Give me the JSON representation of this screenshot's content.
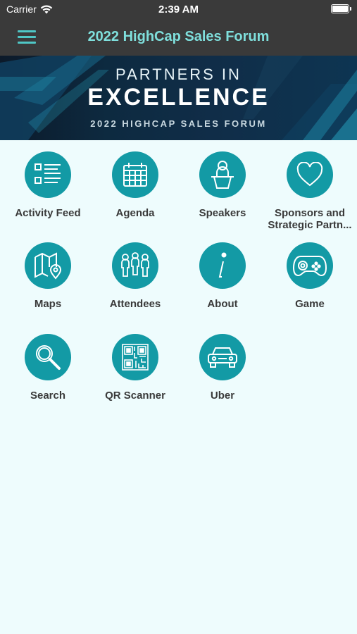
{
  "status": {
    "carrier": "Carrier",
    "time": "2:39 AM"
  },
  "nav": {
    "title": "2022 HighCap Sales Forum",
    "menu_icon": "hamburger-menu-icon"
  },
  "banner": {
    "line1": "PARTNERS IN",
    "line2": "EXCELLENCE",
    "line3": "2022 HIGHCAP SALES FORUM"
  },
  "tiles": [
    {
      "label": "Activity Feed",
      "icon": "list-icon"
    },
    {
      "label": "Agenda",
      "icon": "calendar-icon"
    },
    {
      "label": "Speakers",
      "icon": "podium-speaker-icon"
    },
    {
      "label_line1": "Sponsors and",
      "label_line2": "Strategic Partn...",
      "icon": "heart-icon"
    },
    {
      "label": "Maps",
      "icon": "map-icon"
    },
    {
      "label": "Attendees",
      "icon": "people-group-icon"
    },
    {
      "label": "About",
      "icon": "info-icon"
    },
    {
      "label": "Game",
      "icon": "gamepad-icon"
    },
    {
      "label": "Search",
      "icon": "search-icon"
    },
    {
      "label": "QR Scanner",
      "icon": "qr-code-icon"
    },
    {
      "label": "Uber",
      "icon": "car-icon"
    }
  ],
  "colors": {
    "accent": "#139aa5",
    "bar": "#3a3a3a",
    "title": "#7fdfdc",
    "background": "#eefcfd"
  }
}
